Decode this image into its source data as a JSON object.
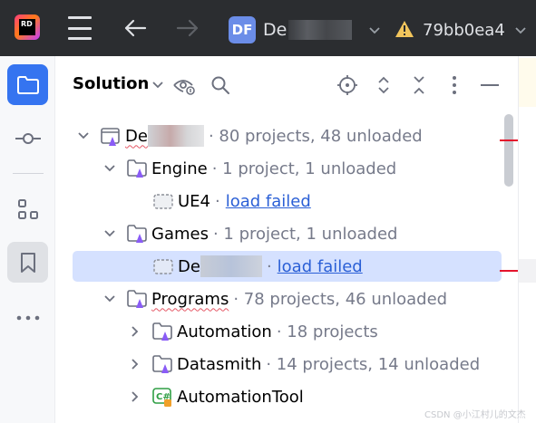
{
  "titlebar": {
    "logo_text": "RD",
    "project_badge": "DF",
    "project_name": "De",
    "branch": "79bb0ea4"
  },
  "left_strip": {
    "items": [
      "project-folder-icon",
      "commit-icon",
      "structure-icon",
      "bookmarks-icon",
      "more-icon"
    ]
  },
  "panel": {
    "title": "Solution"
  },
  "tree": [
    {
      "name": "De",
      "meta": "· 80 projects, 48 unloaded",
      "link": "",
      "expanded": true,
      "kind": "solution",
      "redacted": true
    },
    {
      "name": "Engine",
      "meta": "· 1 project, 1 unloaded",
      "link": "",
      "expanded": true,
      "kind": "folder"
    },
    {
      "name": "UE4",
      "meta": "·",
      "link": "load failed",
      "kind": "unloaded"
    },
    {
      "name": "Games",
      "meta": "· 1 project, 1 unloaded",
      "link": "",
      "expanded": true,
      "kind": "folder"
    },
    {
      "name": "De",
      "meta": "·",
      "link": "load failed",
      "kind": "unloaded",
      "selected": true,
      "redacted": true
    },
    {
      "name": "Programs",
      "meta": "· 78 projects, 46 unloaded",
      "link": "",
      "expanded": true,
      "kind": "folder"
    },
    {
      "name": "Automation",
      "meta": "· 18 projects",
      "link": "",
      "expanded": false,
      "kind": "folder"
    },
    {
      "name": "Datasmith",
      "meta": "· 14 projects, 14 unloaded",
      "link": "",
      "expanded": false,
      "kind": "folder"
    },
    {
      "name": "AutomationTool",
      "meta": "",
      "link": "",
      "expanded": false,
      "kind": "csharp"
    }
  ],
  "watermark": "CSDN @小江村儿的文杰",
  "colors": {
    "accent": "#3574f0",
    "selection": "#d5e1ff",
    "link": "#2a5fd6",
    "titlebar": "#2b2d30",
    "warning": "#f2c55c",
    "error_marker": "#e4142c"
  }
}
